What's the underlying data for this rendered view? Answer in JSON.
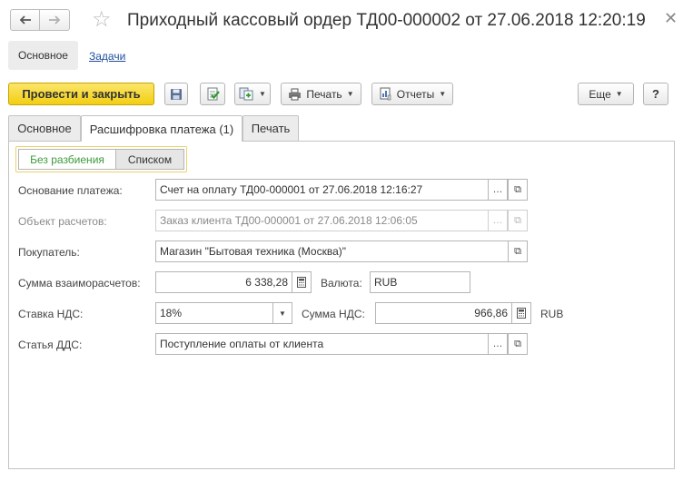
{
  "window": {
    "title": "Приходный кассовый ордер ТД00-000002 от 27.06.2018 12:20:19",
    "back_icon": "arrow-left-icon",
    "forward_icon": "arrow-right-icon",
    "favorite_icon": "star-icon",
    "close_icon": "close-icon"
  },
  "nav_links": {
    "main": "Основное",
    "tasks": "Задачи"
  },
  "toolbar": {
    "post_close": "Провести и закрыть",
    "print": "Печать",
    "reports": "Отчеты",
    "more": "Еще",
    "help": "?",
    "icons": [
      "save-icon",
      "post-document-icon",
      "create-based-on-icon",
      "printer-icon",
      "reports-icon"
    ]
  },
  "tabs": [
    {
      "label": "Основное",
      "active": false
    },
    {
      "label": "Расшифровка платежа (1)",
      "active": true
    },
    {
      "label": "Печать",
      "active": false
    }
  ],
  "split_toggle": {
    "without_split": "Без разбиения",
    "list": "Списком",
    "selected": "Без разбиения"
  },
  "form": {
    "payment_basis": {
      "label": "Основание платежа:",
      "value": "Счет на оплату ТД00-000001 от 27.06.2018 12:16:27"
    },
    "settlement_object": {
      "label": "Объект расчетов:",
      "value": "Заказ клиента ТД00-000001 от 27.06.2018 12:06:05"
    },
    "buyer": {
      "label": "Покупатель:",
      "value": "Магазин \"Бытовая техника (Москва)\""
    },
    "settlement_amount": {
      "label": "Сумма взаиморасчетов:",
      "value": "6 338,28"
    },
    "currency": {
      "label": "Валюта:",
      "value": "RUB"
    },
    "vat_rate": {
      "label": "Ставка НДС:",
      "value": "18%"
    },
    "vat_amount": {
      "label": "Сумма НДС:",
      "value": "966,86",
      "currency": "RUB"
    },
    "cash_flow_item": {
      "label": "Статья ДДС:",
      "value": "Поступление оплаты от клиента"
    }
  },
  "colors": {
    "primary_button": "#f2cf12",
    "link": "#1f4e9c",
    "toggle_selected_text": "#3a9b3a"
  }
}
